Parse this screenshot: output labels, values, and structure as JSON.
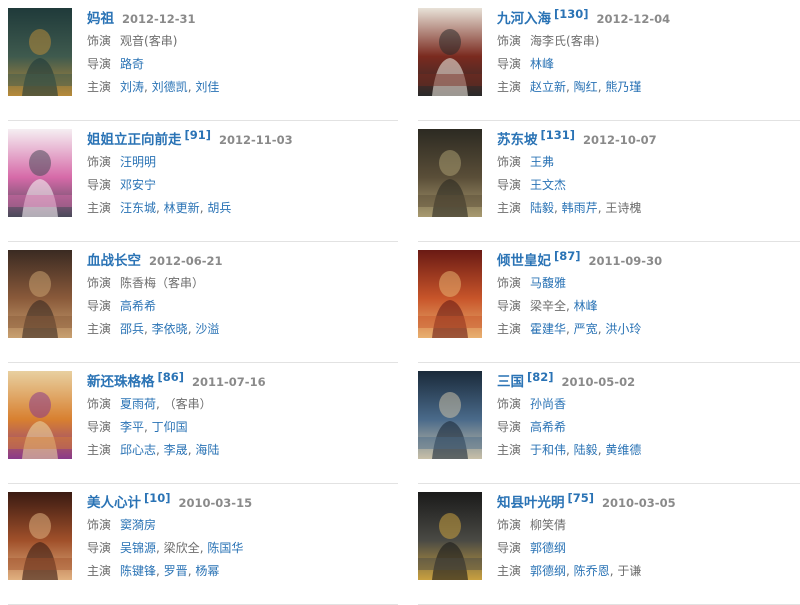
{
  "labels": {
    "role": "饰演",
    "director": "导演",
    "cast": "主演"
  },
  "entries": [
    {
      "title": "妈祖",
      "count": "",
      "date": "2012-12-31",
      "poster_icon": "poster-icon",
      "poster_colors": [
        "#1f3a3a",
        "#3f5a4e",
        "#b78a3a"
      ],
      "role": [
        {
          "text": "观音(客串)",
          "link": false
        }
      ],
      "director": [
        {
          "text": "路奇",
          "link": true
        }
      ],
      "cast": [
        {
          "text": "刘涛",
          "link": true
        },
        {
          "text": "刘德凯",
          "link": true
        },
        {
          "text": "刘佳",
          "link": true
        }
      ]
    },
    {
      "title": "九河入海",
      "count": "[130]",
      "date": "2012-12-04",
      "poster_icon": "poster-icon",
      "poster_colors": [
        "#e8e2d8",
        "#7a2a1f",
        "#2a2a2a"
      ],
      "role": [
        {
          "text": "海李氏(客串)",
          "link": false
        }
      ],
      "director": [
        {
          "text": "林峰",
          "link": true
        }
      ],
      "cast": [
        {
          "text": "赵立新",
          "link": true
        },
        {
          "text": "陶红",
          "link": true
        },
        {
          "text": "熊乃瑾",
          "link": true
        }
      ]
    },
    {
      "title": "姐姐立正向前走",
      "count": "[91]",
      "date": "2012-11-03",
      "poster_icon": "poster-icon",
      "poster_colors": [
        "#f5eef2",
        "#d66aa8",
        "#4a4a5a"
      ],
      "role": [
        {
          "text": "汪明明",
          "link": true
        }
      ],
      "director": [
        {
          "text": "邓安宁",
          "link": true
        }
      ],
      "cast": [
        {
          "text": "汪东城",
          "link": true
        },
        {
          "text": "林更新",
          "link": true
        },
        {
          "text": "胡兵",
          "link": true
        }
      ]
    },
    {
      "title": "苏东坡",
      "count": "[131]",
      "date": "2012-10-07",
      "poster_icon": "poster-icon",
      "poster_colors": [
        "#2c2a22",
        "#5a4e38",
        "#a89a70"
      ],
      "role": [
        {
          "text": "王弗",
          "link": true
        }
      ],
      "director": [
        {
          "text": "王文杰",
          "link": true
        }
      ],
      "cast": [
        {
          "text": "陆毅",
          "link": true
        },
        {
          "text": "韩雨芹",
          "link": true
        },
        {
          "text": "王诗槐",
          "link": false
        }
      ]
    },
    {
      "title": "血战长空",
      "count": "",
      "date": "2012-06-21",
      "poster_icon": "poster-icon",
      "poster_colors": [
        "#3a2a22",
        "#8a5a3a",
        "#c8a070"
      ],
      "role": [
        {
          "text": "陈香梅（客串）",
          "link": false
        }
      ],
      "director": [
        {
          "text": "高希希",
          "link": true
        }
      ],
      "cast": [
        {
          "text": "邵兵",
          "link": true
        },
        {
          "text": "李依晓",
          "link": true
        },
        {
          "text": "沙溢",
          "link": true
        }
      ]
    },
    {
      "title": "倾世皇妃",
      "count": "[87]",
      "date": "2011-09-30",
      "poster_icon": "poster-icon",
      "poster_colors": [
        "#6a1a14",
        "#c8552a",
        "#e8b070"
      ],
      "role": [
        {
          "text": "马馥雅",
          "link": true
        }
      ],
      "director": [
        {
          "text": "梁辛全",
          "link": false
        },
        {
          "text": "林峰",
          "link": true
        }
      ],
      "cast": [
        {
          "text": "霍建华",
          "link": true
        },
        {
          "text": "严宽",
          "link": true
        },
        {
          "text": "洪小玲",
          "link": true
        }
      ]
    },
    {
      "title": "新还珠格格",
      "count": "[86]",
      "date": "2011-07-16",
      "poster_icon": "poster-icon",
      "poster_colors": [
        "#e8d0a0",
        "#d88030",
        "#8a3a8a"
      ],
      "role": [
        {
          "text": "夏雨荷",
          "link": true
        },
        {
          "text": "（客串）",
          "link": false
        }
      ],
      "director": [
        {
          "text": "李平",
          "link": true
        },
        {
          "text": "丁仰国",
          "link": true
        }
      ],
      "cast": [
        {
          "text": "邱心志",
          "link": true
        },
        {
          "text": "李晟",
          "link": true
        },
        {
          "text": "海陆",
          "link": true
        }
      ]
    },
    {
      "title": "三国",
      "count": "[82]",
      "date": "2010-05-02",
      "poster_icon": "poster-icon",
      "poster_colors": [
        "#1a2a3a",
        "#4a6a8a",
        "#c8c0a8"
      ],
      "role": [
        {
          "text": "孙尚香",
          "link": true
        }
      ],
      "director": [
        {
          "text": "高希希",
          "link": true
        }
      ],
      "cast": [
        {
          "text": "于和伟",
          "link": true
        },
        {
          "text": "陆毅",
          "link": true
        },
        {
          "text": "黄维德",
          "link": true
        }
      ]
    },
    {
      "title": "美人心计",
      "count": "[10]",
      "date": "2010-03-15",
      "poster_icon": "poster-icon",
      "poster_colors": [
        "#3a1a12",
        "#a0502a",
        "#e0b080"
      ],
      "role": [
        {
          "text": "窦漪房",
          "link": true
        }
      ],
      "director": [
        {
          "text": "吴锦源",
          "link": true
        },
        {
          "text": "梁欣全",
          "link": false
        },
        {
          "text": "陈国华",
          "link": true
        }
      ],
      "cast": [
        {
          "text": "陈键锋",
          "link": true
        },
        {
          "text": "罗晋",
          "link": true
        },
        {
          "text": "杨幂",
          "link": true
        }
      ]
    },
    {
      "title": "知县叶光明",
      "count": "[75]",
      "date": "2010-03-05",
      "poster_icon": "poster-icon",
      "poster_colors": [
        "#1a1a1a",
        "#4a4a44",
        "#c8a040"
      ],
      "role": [
        {
          "text": "柳笑倩",
          "link": false
        }
      ],
      "director": [
        {
          "text": "郭德纲",
          "link": true
        }
      ],
      "cast": [
        {
          "text": "郭德纲",
          "link": true
        },
        {
          "text": "陈乔恩",
          "link": true
        },
        {
          "text": "于谦",
          "link": false
        }
      ]
    }
  ]
}
